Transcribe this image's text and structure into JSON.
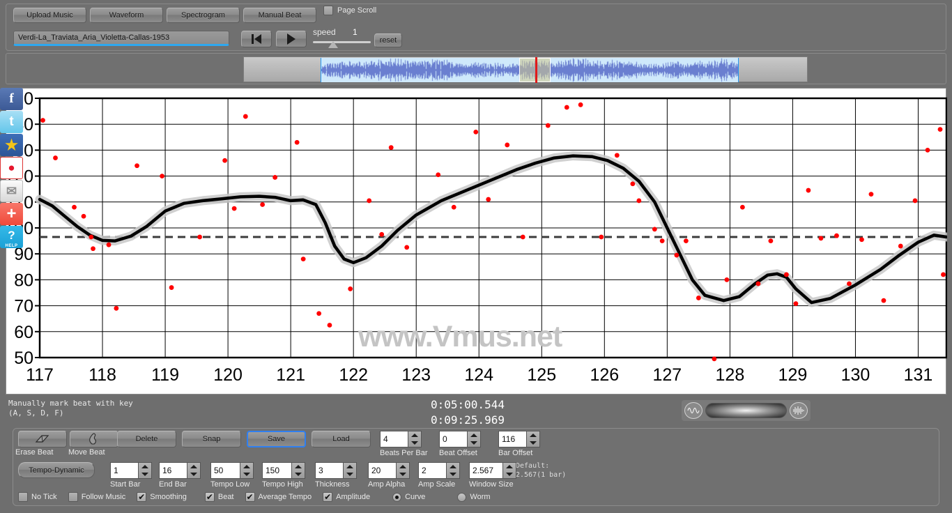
{
  "toolbar": {
    "buttons": [
      {
        "label": "Upload Music",
        "name": "upload-music-button"
      },
      {
        "label": "Waveform",
        "name": "waveform-button"
      },
      {
        "label": "Spectrogram",
        "name": "spectrogram-button"
      },
      {
        "label": "Manual Beat",
        "name": "manual-beat-button"
      }
    ],
    "page_scroll_label": "Page Scroll",
    "page_scroll_checked": false,
    "filename": "Verdi-La_Traviata_Aria_Violetta-Callas-1953",
    "speed_label": "speed",
    "speed_value": "1",
    "reset_label": "reset"
  },
  "social": [
    {
      "name": "facebook-icon",
      "glyph": "f"
    },
    {
      "name": "twitter-icon",
      "glyph": "t"
    },
    {
      "name": "qzone-icon",
      "glyph": "★"
    },
    {
      "name": "weibo-icon",
      "glyph": "●"
    },
    {
      "name": "email-icon",
      "glyph": "✉"
    },
    {
      "name": "share-plus-icon",
      "glyph": "+"
    },
    {
      "name": "help-icon",
      "glyph": "?",
      "sub": "HELP"
    }
  ],
  "watermark": "www.Vmus.net",
  "status": {
    "hint_line1": "Manually mark beat with key",
    "hint_line2": "(A, S, D, F)",
    "time_current": "0:05:00.544",
    "time_total": "0:09:25.969"
  },
  "controls": {
    "erase_beat": "Erase Beat",
    "move_beat": "Move Beat",
    "delete": "Delete",
    "snap": "Snap",
    "save": "Save",
    "load": "Load",
    "tempo_mode": "Tempo-Dynamic",
    "default_note_line1": "Default:",
    "default_note_line2": "2.567(1 bar)",
    "spinners": [
      {
        "name": "start-bar",
        "caption": "Start Bar",
        "value": "1"
      },
      {
        "name": "end-bar",
        "caption": "End Bar",
        "value": "16"
      },
      {
        "name": "tempo-low",
        "caption": "Tempo Low",
        "value": "50"
      },
      {
        "name": "tempo-high",
        "caption": "Tempo High",
        "value": "150"
      },
      {
        "name": "thickness",
        "caption": "Thickness",
        "value": "3"
      },
      {
        "name": "amp-alpha",
        "caption": "Amp Alpha",
        "value": "20"
      },
      {
        "name": "amp-scale",
        "caption": "Amp Scale",
        "value": "2"
      },
      {
        "name": "window-size",
        "caption": "Window Size",
        "value": "2.567"
      },
      {
        "name": "beats-per-bar",
        "caption": "Beats Per Bar",
        "value": "4"
      },
      {
        "name": "beat-offset",
        "caption": "Beat Offset",
        "value": "0"
      },
      {
        "name": "bar-offset",
        "caption": "Bar Offset",
        "value": "116"
      }
    ],
    "checkboxes": [
      {
        "name": "no-tick",
        "label": "No Tick",
        "checked": false
      },
      {
        "name": "follow-music",
        "label": "Follow Music",
        "checked": false
      },
      {
        "name": "smoothing",
        "label": "Smoothing",
        "checked": true
      },
      {
        "name": "beat",
        "label": "Beat",
        "checked": true
      },
      {
        "name": "average-tempo",
        "label": "Average Tempo",
        "checked": true
      },
      {
        "name": "amplitude",
        "label": "Amplitude",
        "checked": true
      }
    ],
    "radios": [
      {
        "name": "curve",
        "label": "Curve",
        "selected": true
      },
      {
        "name": "worm",
        "label": "Worm",
        "selected": false
      }
    ]
  },
  "chart_data": {
    "type": "line",
    "title": "",
    "xlabel": "",
    "ylabel": "",
    "xlim": [
      117,
      131.45
    ],
    "ylim": [
      50,
      150
    ],
    "yticks": [
      50,
      60,
      70,
      80,
      90,
      100,
      110,
      120,
      130,
      140,
      150
    ],
    "xticks": [
      117,
      118,
      119,
      120,
      121,
      122,
      123,
      124,
      125,
      126,
      127,
      128,
      129,
      130,
      131
    ],
    "grid": true,
    "legend": null,
    "average_tempo_line": 96.5,
    "accent_color": "#ff0000",
    "curve_color": "#000000",
    "band_color": "#c8c8c8",
    "series": [
      {
        "name": "smoothed tempo curve",
        "x": [
          117.0,
          117.2,
          117.4,
          117.6,
          117.8,
          118.0,
          118.2,
          118.45,
          118.7,
          119.0,
          119.3,
          119.6,
          119.9,
          120.2,
          120.5,
          120.75,
          121.0,
          121.2,
          121.4,
          121.55,
          121.7,
          121.85,
          122.0,
          122.2,
          122.45,
          122.7,
          123.0,
          123.4,
          123.8,
          124.2,
          124.6,
          124.9,
          125.2,
          125.5,
          125.8,
          126.05,
          126.3,
          126.55,
          126.8,
          127.0,
          127.2,
          127.4,
          127.6,
          127.9,
          128.15,
          128.4,
          128.6,
          128.75,
          128.9,
          129.05,
          129.3,
          129.6,
          130.0,
          130.4,
          130.7,
          131.0,
          131.25,
          131.45
        ],
        "y": [
          111.0,
          108.5,
          104.5,
          100.5,
          97.2,
          95.2,
          95.0,
          96.8,
          100.5,
          106.5,
          109.5,
          110.5,
          111.2,
          112.0,
          112.2,
          111.8,
          110.5,
          110.8,
          109.0,
          102.0,
          93.0,
          88.0,
          86.6,
          88.5,
          93.0,
          99.0,
          105.0,
          110.5,
          114.5,
          118.5,
          122.5,
          125.0,
          127.0,
          127.8,
          127.5,
          126.0,
          123.0,
          118.0,
          110.0,
          100.0,
          90.0,
          80.0,
          74.0,
          72.0,
          73.5,
          78.5,
          81.8,
          82.3,
          81.0,
          76.5,
          71.2,
          72.8,
          78.0,
          84.0,
          89.5,
          94.5,
          97.2,
          96.5
        ]
      },
      {
        "name": "beat tempo points",
        "mode": "scatter",
        "points": [
          [
            117.05,
            141.5
          ],
          [
            117.25,
            127.0
          ],
          [
            117.55,
            108.0
          ],
          [
            117.7,
            104.5
          ],
          [
            117.82,
            96.5
          ],
          [
            117.85,
            92.0
          ],
          [
            118.1,
            93.5
          ],
          [
            118.22,
            69.0
          ],
          [
            118.55,
            124.0
          ],
          [
            118.95,
            120.0
          ],
          [
            119.1,
            77.0
          ],
          [
            119.55,
            96.5
          ],
          [
            119.95,
            126.0
          ],
          [
            120.1,
            107.5
          ],
          [
            120.28,
            143.0
          ],
          [
            120.55,
            109.0
          ],
          [
            120.75,
            119.5
          ],
          [
            121.1,
            133.0
          ],
          [
            121.2,
            88.0
          ],
          [
            121.45,
            67.0
          ],
          [
            121.62,
            62.5
          ],
          [
            121.95,
            76.5
          ],
          [
            122.25,
            110.5
          ],
          [
            122.45,
            97.5
          ],
          [
            122.6,
            131.0
          ],
          [
            122.85,
            92.5
          ],
          [
            123.35,
            120.5
          ],
          [
            123.6,
            108.0
          ],
          [
            123.95,
            137.0
          ],
          [
            124.15,
            111.0
          ],
          [
            124.45,
            132.0
          ],
          [
            124.7,
            96.5
          ],
          [
            125.1,
            139.5
          ],
          [
            125.4,
            146.5
          ],
          [
            125.62,
            147.5
          ],
          [
            125.95,
            96.5
          ],
          [
            126.2,
            128.0
          ],
          [
            126.45,
            117.0
          ],
          [
            126.55,
            110.5
          ],
          [
            126.8,
            99.5
          ],
          [
            126.92,
            95.0
          ],
          [
            127.15,
            89.5
          ],
          [
            127.3,
            95.0
          ],
          [
            127.5,
            73.0
          ],
          [
            127.75,
            49.5
          ],
          [
            127.95,
            80.0
          ],
          [
            128.2,
            108.0
          ],
          [
            128.45,
            78.5
          ],
          [
            128.65,
            95.0
          ],
          [
            128.9,
            82.0
          ],
          [
            129.05,
            70.8
          ],
          [
            129.25,
            114.5
          ],
          [
            129.45,
            96.0
          ],
          [
            129.7,
            97.0
          ],
          [
            129.9,
            78.5
          ],
          [
            130.1,
            95.5
          ],
          [
            130.25,
            113.0
          ],
          [
            130.45,
            72.0
          ],
          [
            130.72,
            93.0
          ],
          [
            130.95,
            110.5
          ],
          [
            131.15,
            130.0
          ],
          [
            131.35,
            138.0
          ],
          [
            131.4,
            82.0
          ]
        ]
      }
    ]
  }
}
